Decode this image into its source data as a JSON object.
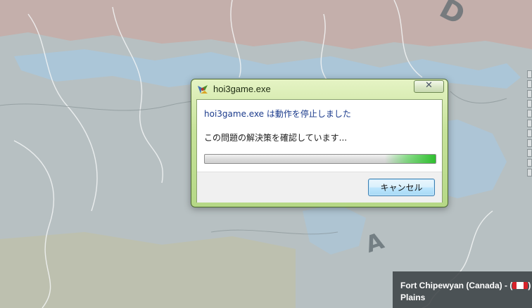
{
  "map": {
    "letters": [
      "D",
      "A"
    ],
    "colors": {
      "land": "#b7c0c2",
      "water": "#a9c7dc",
      "region_pink": "#c8a9a3",
      "region_yellow": "#c6c29a"
    }
  },
  "side_panel": {
    "button_count": 11
  },
  "tooltip": {
    "line1": "Fort Chipewyan (Canada) - (",
    "line1_end": ")",
    "line2": "Plains",
    "flag_icon": "flag-icon"
  },
  "dialog": {
    "title": "hoi3game.exe",
    "close_label": "✕",
    "headline": "hoi3game.exe は動作を停止しました",
    "status": "この問題の解決策を確認しています...",
    "progress": {
      "type": "marquee",
      "glow_start": 0.78,
      "glow_end": 1.0
    },
    "cancel_label": "キャンセル",
    "icons": {
      "app": "app-icon",
      "close": "close-icon"
    }
  }
}
